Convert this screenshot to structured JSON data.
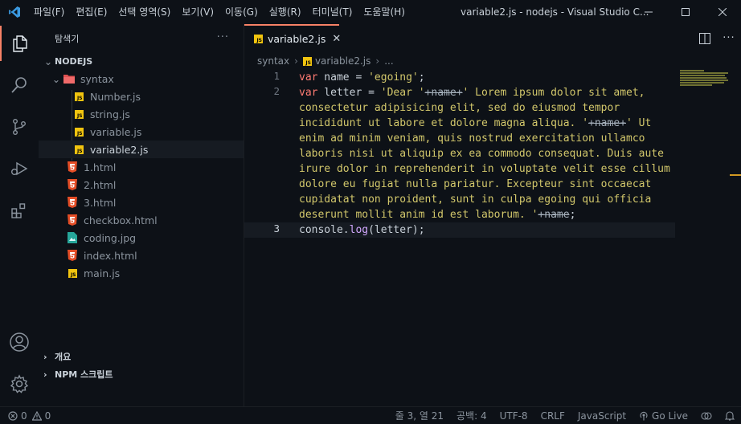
{
  "menu": [
    "파일(F)",
    "편집(E)",
    "선택 영역(S)",
    "보기(V)",
    "이동(G)",
    "실행(R)",
    "터미널(T)",
    "도움말(H)"
  ],
  "window_title": "variable2.js - nodejs - Visual Studio C...",
  "sidebar": {
    "title": "탐색기",
    "more": "···",
    "root": "NODEJS",
    "tree": [
      {
        "label": "syntax",
        "kind": "folder",
        "depth": 1
      },
      {
        "label": "Number.js",
        "kind": "js",
        "depth": 2
      },
      {
        "label": "string.js",
        "kind": "js",
        "depth": 2
      },
      {
        "label": "variable.js",
        "kind": "js",
        "depth": 2
      },
      {
        "label": "variable2.js",
        "kind": "js",
        "depth": 2,
        "selected": true
      },
      {
        "label": "1.html",
        "kind": "html",
        "depth": 1
      },
      {
        "label": "2.html",
        "kind": "html",
        "depth": 1
      },
      {
        "label": "3.html",
        "kind": "html",
        "depth": 1
      },
      {
        "label": "checkbox.html",
        "kind": "html",
        "depth": 1
      },
      {
        "label": "coding.jpg",
        "kind": "img",
        "depth": 1
      },
      {
        "label": "index.html",
        "kind": "html",
        "depth": 1
      },
      {
        "label": "main.js",
        "kind": "js",
        "depth": 1
      }
    ],
    "outline": "개요",
    "npm": "NPM 스크립트"
  },
  "tab": {
    "label": "variable2.js",
    "close": "✕"
  },
  "breadcrumb": {
    "folder": "syntax",
    "file": "variable2.js",
    "more": "..."
  },
  "line_numbers": [
    "1",
    "2",
    "3"
  ],
  "code": {
    "l1_kw": "var",
    "l1_rest": " name = ",
    "l1_str": "'egoing'",
    "l1_end": ";",
    "l2_kw": "var",
    "l2_rest": " letter = ",
    "l2_a": "'Dear '",
    "l2_a2": "+name+",
    "l2_b": "' Lorem ipsum dolor sit amet,",
    "l2_c": "consectetur adipisicing elit, sed do eiusmod tempor",
    "l2_d": "incididunt ut labore et dolore magna aliqua. '",
    "l2_d2": "+name+",
    "l2_d3": "' Ut",
    "l2_e": "enim ad minim veniam, quis nostrud exercitation ullamco",
    "l2_f": "laboris nisi ut aliquip ex ea commodo consequat. Duis aute",
    "l2_g": "irure dolor in reprehenderit in voluptate velit esse cillum",
    "l2_h": "dolore eu fugiat nulla pariatur. Excepteur sint occaecat",
    "l2_i": "cupidatat non proident, sunt in culpa egoing qui officia",
    "l2_j": "deserunt mollit anim id est laborum. '",
    "l2_j2": "+name",
    "l2_j3": ";",
    "l3_obj": "console",
    "l3_dot": ".",
    "l3_fn": "log",
    "l3_rest": "(letter);"
  },
  "status": {
    "errors": "0",
    "warnings": "0",
    "position": "줄 3, 열 21",
    "spaces": "공백: 4",
    "encoding": "UTF-8",
    "eol": "CRLF",
    "language": "JavaScript",
    "golive": "Go Live"
  },
  "colors": {
    "accent": "#f78166",
    "js": "#f1c40f",
    "html": "#e44d26"
  }
}
